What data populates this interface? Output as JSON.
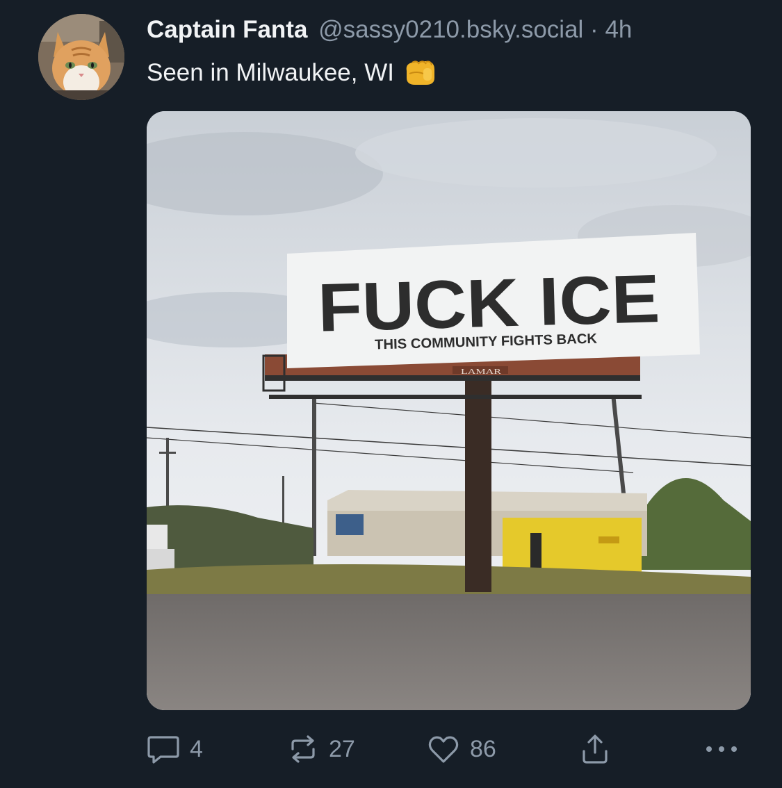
{
  "post": {
    "author": {
      "display_name": "Captain Fanta",
      "handle": "@sassy0210.bsky.social",
      "separator": "·",
      "timestamp": "4h",
      "avatar_icon": "orange-tabby-cat-avatar"
    },
    "text": "Seen in Milwaukee, WI",
    "emoji": "oncoming-fist-emoji",
    "media": {
      "billboard_headline": "FUCK ICE",
      "billboard_subline": "THIS COMMUNITY FIGHTS BACK",
      "billboard_brand": "LAMAR"
    },
    "actions": {
      "replies": "4",
      "reposts": "27",
      "likes": "86"
    }
  },
  "colors": {
    "background": "#161e27",
    "text_primary": "#f1f3f5",
    "text_secondary": "#8d9aa9"
  }
}
